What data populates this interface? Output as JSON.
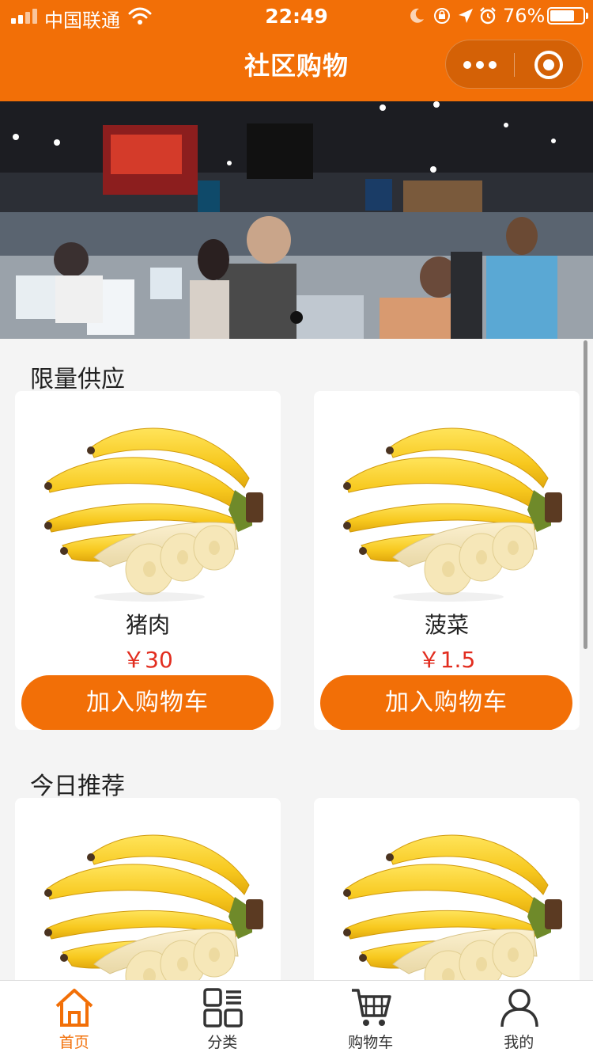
{
  "status_bar": {
    "carrier": "中国联通",
    "time": "22:49",
    "battery": "76%",
    "battery_level": 0.76
  },
  "nav": {
    "title": "社区购物"
  },
  "banner": {
    "page_count": 1,
    "current": 1
  },
  "sections": [
    {
      "title": "限量供应",
      "products": [
        {
          "name": "猪肉",
          "price": "￥30",
          "button": "加入购物车"
        },
        {
          "name": "菠菜",
          "price": "￥1.5",
          "button": "加入购物车"
        }
      ]
    },
    {
      "title": "今日推荐",
      "products": [
        {
          "name": "",
          "price": "",
          "button": ""
        },
        {
          "name": "",
          "price": "",
          "button": ""
        }
      ]
    }
  ],
  "tabbar": {
    "items": [
      {
        "label": "首页",
        "icon": "home-icon",
        "active": true
      },
      {
        "label": "分类",
        "icon": "category-icon",
        "active": false
      },
      {
        "label": "购物车",
        "icon": "cart-icon",
        "active": false
      },
      {
        "label": "我的",
        "icon": "user-icon",
        "active": false
      }
    ]
  },
  "colors": {
    "accent": "#f26f07",
    "price": "#e22d1f"
  }
}
